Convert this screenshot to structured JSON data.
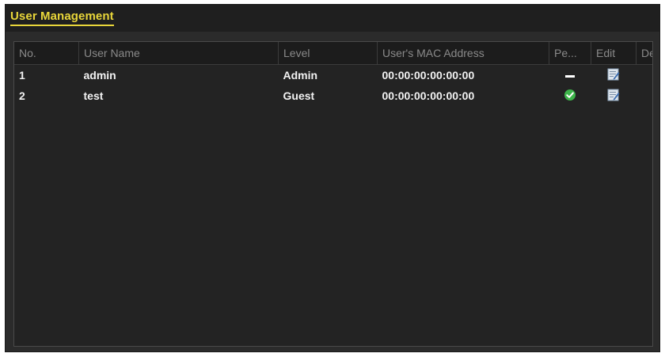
{
  "window": {
    "title": "User Management"
  },
  "table": {
    "columns": [
      "No.",
      "User Name",
      "Level",
      "User's MAC Address",
      "Pe...",
      "Edit",
      "Del..."
    ],
    "rows": [
      {
        "no": "1",
        "user_name": "admin",
        "level": "Admin",
        "mac": "00:00:00:00:00:00",
        "permission": "dash-icon",
        "edit": "edit-icon",
        "delete": "dash-icon"
      },
      {
        "no": "2",
        "user_name": "test",
        "level": "Guest",
        "mac": "00:00:00:00:00:00",
        "permission": "check-icon",
        "edit": "edit-icon",
        "delete": "trash-icon"
      }
    ]
  },
  "colors": {
    "title_accent": "#e9d63a",
    "check_green": "#3db54a",
    "delete_red": "#d42a1e",
    "background": "#2b2b2b"
  }
}
